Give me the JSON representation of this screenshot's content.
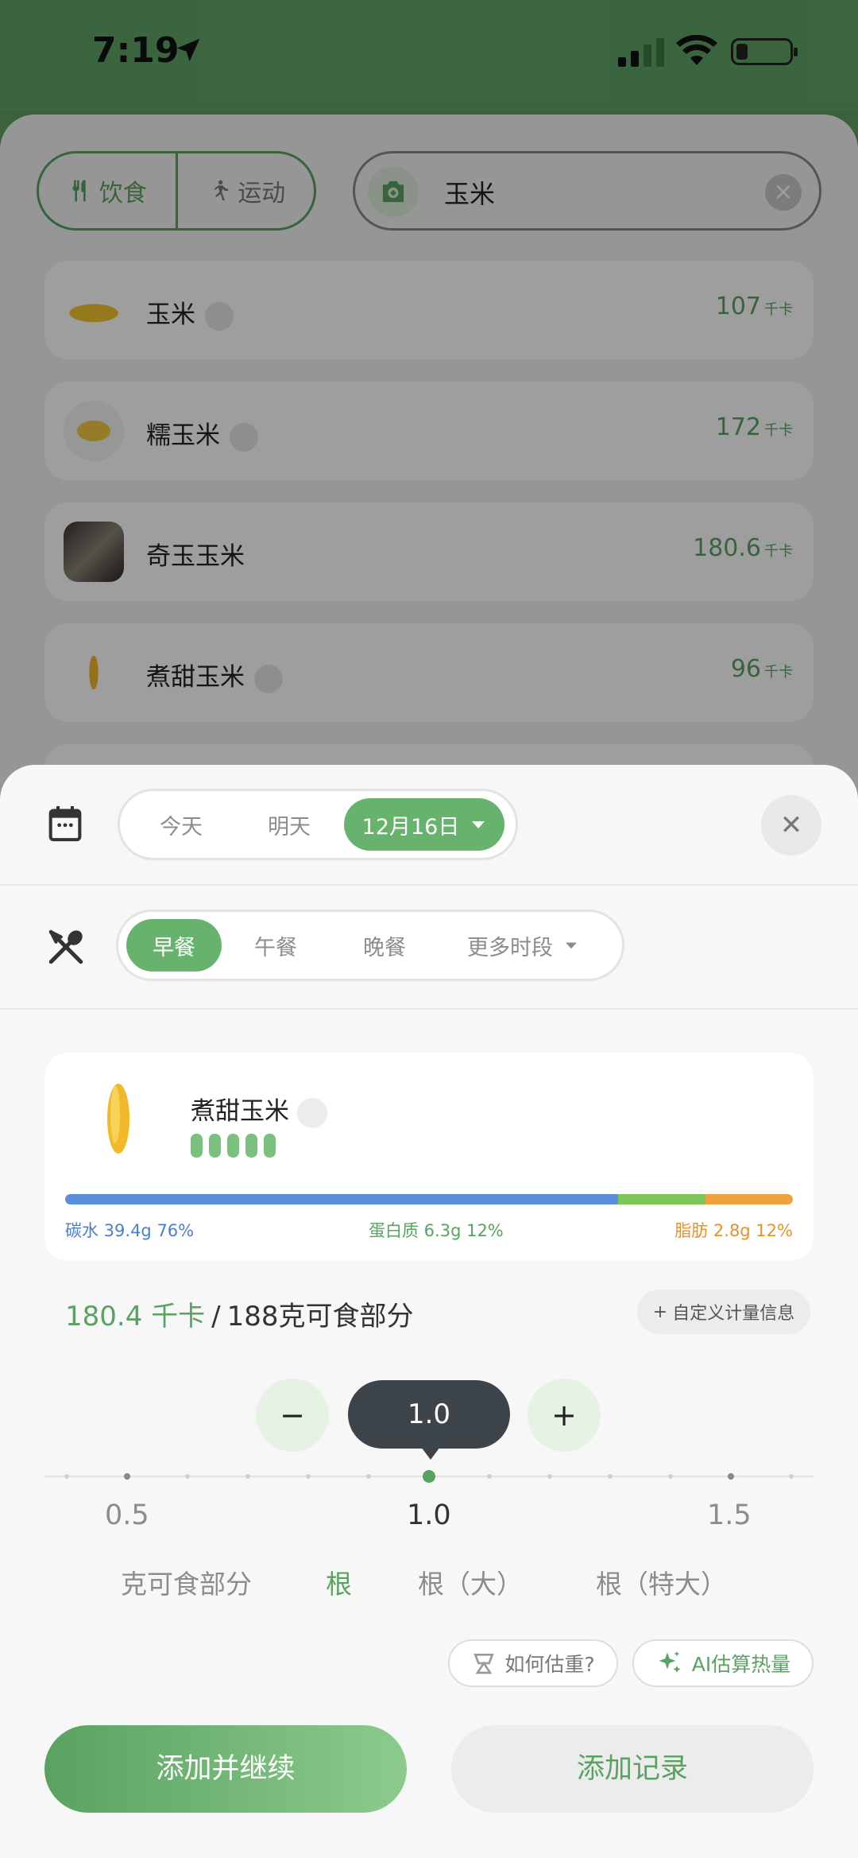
{
  "status_bar": {
    "time": "7:19"
  },
  "search_header": {
    "tab_diet": "饮食",
    "tab_exercise": "运动",
    "query": "玉米"
  },
  "results": [
    {
      "name": "玉米",
      "kcal": "107",
      "unit": "千卡"
    },
    {
      "name": "糯玉米",
      "kcal": "172",
      "unit": "千卡"
    },
    {
      "name": "奇玉玉米",
      "kcal": "180.6",
      "unit": "千卡"
    },
    {
      "name": "煮甜玉米",
      "kcal": "96",
      "unit": "千卡"
    }
  ],
  "sheet": {
    "days": [
      "今天",
      "明天",
      "12月16日"
    ],
    "selected_day": "12月16日",
    "meals": [
      "早餐",
      "午餐",
      "晚餐",
      "更多时段"
    ],
    "selected_meal": "早餐",
    "food": {
      "name": "煮甜玉米",
      "rating_level": 5,
      "macros": [
        {
          "label": "碳水 39.4g 76%",
          "pct": 76,
          "color": "#5b8fde"
        },
        {
          "label": "蛋白质 6.3g 12%",
          "pct": 12,
          "color": "#7dc75a"
        },
        {
          "label": "脂肪 2.8g 12%",
          "pct": 12,
          "color": "#f0a03c"
        }
      ]
    },
    "energy": {
      "kcal": "180.4 千卡",
      "separator": "/",
      "portion": "188克可食部分"
    },
    "custom_unit": "自定义计量信息",
    "stepper": {
      "minus": "−",
      "value": "1.0",
      "plus": "+"
    },
    "ruler_labels": [
      "0.5",
      "1.0",
      "1.5"
    ],
    "units": [
      "克可食部分",
      "根",
      "根（大）",
      "根（特大）"
    ],
    "selected_unit": "根",
    "help": {
      "estimate": "如何估重?",
      "ai": "AI估算热量"
    },
    "actions": {
      "add_continue": "添加并继续",
      "add": "添加记录"
    },
    "colors": {
      "accent": "#5aa261",
      "stepper_bg": "#3d444a"
    }
  }
}
